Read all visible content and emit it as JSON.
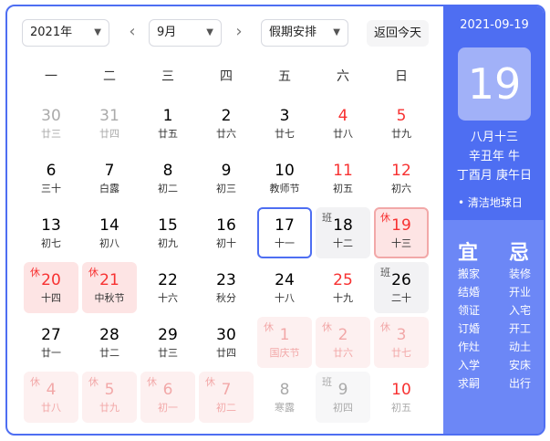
{
  "toolbar": {
    "year": "2021年",
    "month": "9月",
    "holiday": "假期安排",
    "today_button": "返回今天",
    "prev": "‹",
    "next": "›"
  },
  "weekdays": [
    "一",
    "二",
    "三",
    "四",
    "五",
    "六",
    "日"
  ],
  "days": [
    {
      "n": "30",
      "l": "廿三",
      "other": true
    },
    {
      "n": "31",
      "l": "廿四",
      "other": true
    },
    {
      "n": "1",
      "l": "廿五"
    },
    {
      "n": "2",
      "l": "廿六"
    },
    {
      "n": "3",
      "l": "廿七"
    },
    {
      "n": "4",
      "l": "廿八",
      "red": true
    },
    {
      "n": "5",
      "l": "廿九",
      "red": true
    },
    {
      "n": "6",
      "l": "三十"
    },
    {
      "n": "7",
      "l": "白露"
    },
    {
      "n": "8",
      "l": "初二"
    },
    {
      "n": "9",
      "l": "初三"
    },
    {
      "n": "10",
      "l": "教师节"
    },
    {
      "n": "11",
      "l": "初五",
      "red": true
    },
    {
      "n": "12",
      "l": "初六",
      "red": true
    },
    {
      "n": "13",
      "l": "初七"
    },
    {
      "n": "14",
      "l": "初八"
    },
    {
      "n": "15",
      "l": "初九"
    },
    {
      "n": "16",
      "l": "初十"
    },
    {
      "n": "17",
      "l": "十一",
      "today": true
    },
    {
      "n": "18",
      "l": "十二",
      "tag": "班",
      "work": true
    },
    {
      "n": "19",
      "l": "十三",
      "tag": "休",
      "rest": true,
      "selected": true
    },
    {
      "n": "20",
      "l": "十四",
      "tag": "休",
      "rest": true,
      "red": true
    },
    {
      "n": "21",
      "l": "中秋节",
      "tag": "休",
      "rest": true,
      "red": true
    },
    {
      "n": "22",
      "l": "十六"
    },
    {
      "n": "23",
      "l": "秋分"
    },
    {
      "n": "24",
      "l": "十八"
    },
    {
      "n": "25",
      "l": "十九",
      "red": true
    },
    {
      "n": "26",
      "l": "二十",
      "tag": "班",
      "work": true
    },
    {
      "n": "27",
      "l": "廿一"
    },
    {
      "n": "28",
      "l": "廿二"
    },
    {
      "n": "29",
      "l": "廿三"
    },
    {
      "n": "30",
      "l": "廿四"
    },
    {
      "n": "1",
      "l": "国庆节",
      "tag": "休",
      "rest": true,
      "other": true
    },
    {
      "n": "2",
      "l": "廿六",
      "tag": "休",
      "rest": true,
      "other": true
    },
    {
      "n": "3",
      "l": "廿七",
      "tag": "休",
      "rest": true,
      "other": true
    },
    {
      "n": "4",
      "l": "廿八",
      "tag": "休",
      "rest": true,
      "other": true
    },
    {
      "n": "5",
      "l": "廿九",
      "tag": "休",
      "rest": true,
      "other": true
    },
    {
      "n": "6",
      "l": "初一",
      "tag": "休",
      "rest": true,
      "other": true
    },
    {
      "n": "7",
      "l": "初二",
      "tag": "休",
      "rest": true,
      "other": true
    },
    {
      "n": "8",
      "l": "寒露",
      "other": true
    },
    {
      "n": "9",
      "l": "初四",
      "tag": "班",
      "work": true,
      "other": true
    },
    {
      "n": "10",
      "l": "初五",
      "other": true,
      "red": true
    }
  ],
  "panel": {
    "date": "2021-09-19",
    "day": "19",
    "lunar1": "八月十三",
    "lunar2": "辛丑年 牛",
    "lunar3": "丁酉月 庚午日",
    "festival": "• 清洁地球日",
    "yi_label": "宜",
    "ji_label": "忌",
    "yi": [
      "搬家",
      "结婚",
      "领证",
      "订婚",
      "作灶",
      "入学",
      "求嗣"
    ],
    "ji": [
      "装修",
      "开业",
      "入宅",
      "开工",
      "动土",
      "安床",
      "出行"
    ]
  },
  "colors": {
    "accent": "#4e6ef2",
    "holiday_red": "#f73131",
    "rest_bg": "#fde4e4"
  }
}
